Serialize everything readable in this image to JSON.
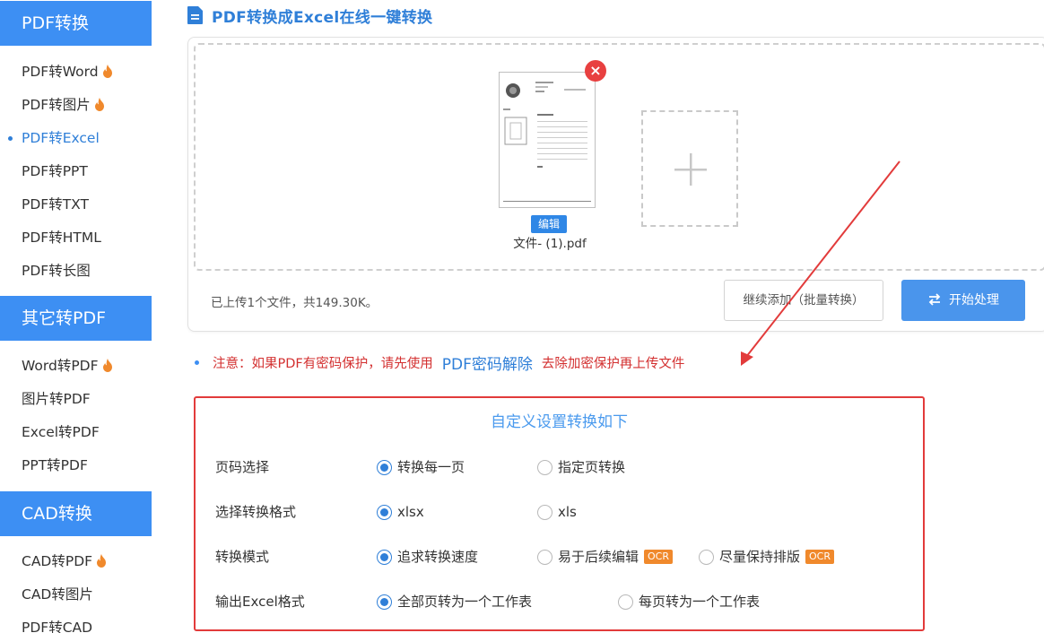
{
  "sidebar": {
    "sections": [
      {
        "title": "PDF转换",
        "items": [
          {
            "label": "PDF转Word",
            "hot": true,
            "active": false
          },
          {
            "label": "PDF转图片",
            "hot": true,
            "active": false
          },
          {
            "label": "PDF转Excel",
            "hot": false,
            "active": true
          },
          {
            "label": "PDF转PPT",
            "hot": false,
            "active": false
          },
          {
            "label": "PDF转TXT",
            "hot": false,
            "active": false
          },
          {
            "label": "PDF转HTML",
            "hot": false,
            "active": false
          },
          {
            "label": "PDF转长图",
            "hot": false,
            "active": false
          }
        ]
      },
      {
        "title": "其它转PDF",
        "items": [
          {
            "label": "Word转PDF",
            "hot": true,
            "active": false
          },
          {
            "label": "图片转PDF",
            "hot": false,
            "active": false
          },
          {
            "label": "Excel转PDF",
            "hot": false,
            "active": false
          },
          {
            "label": "PPT转PDF",
            "hot": false,
            "active": false
          }
        ]
      },
      {
        "title": "CAD转换",
        "items": [
          {
            "label": "CAD转PDF",
            "hot": true,
            "active": false
          },
          {
            "label": "CAD转图片",
            "hot": false,
            "active": false
          },
          {
            "label": "PDF转CAD",
            "hot": false,
            "active": false
          }
        ]
      }
    ]
  },
  "main": {
    "title": "PDF转换成Excel在线一键转换",
    "file": {
      "name": "文件- (1).pdf",
      "edit_label": "编辑",
      "remove_glyph": "×"
    },
    "upload_summary": "已上传1个文件，共149.30K。",
    "continue_label": "继续添加（批量转换）",
    "start_label": "开始处理",
    "notice": {
      "prefix": "注意：如果PDF有密码保护，请先使用",
      "link": "PDF密码解除",
      "suffix": "去除加密保护再上传文件"
    },
    "settings": {
      "title": "自定义设置转换如下",
      "ocr_badge": "OCR",
      "rows": [
        {
          "label": "页码选择",
          "options": [
            "转换每一页",
            "指定页转换"
          ],
          "selected": 0
        },
        {
          "label": "选择转换格式",
          "options": [
            "xlsx",
            "xls"
          ],
          "selected": 0
        },
        {
          "label": "转换模式",
          "options": [
            "追求转换速度",
            "易于后续编辑",
            "尽量保持排版"
          ],
          "selected": 0
        },
        {
          "label": "输出Excel格式",
          "options": [
            "全部页转为一个工作表",
            "每页转为一个工作表"
          ],
          "selected": 0
        }
      ]
    }
  },
  "colors": {
    "accent": "#3d8ff3",
    "notice_red": "#d32f2f",
    "highlight_border": "#e23b3b",
    "hot_flame": "#f0892c"
  },
  "icons": {
    "title": "document-icon",
    "hot": "flame-icon",
    "add": "plus-icon",
    "start": "swap-arrows-icon",
    "remove": "close-icon"
  }
}
